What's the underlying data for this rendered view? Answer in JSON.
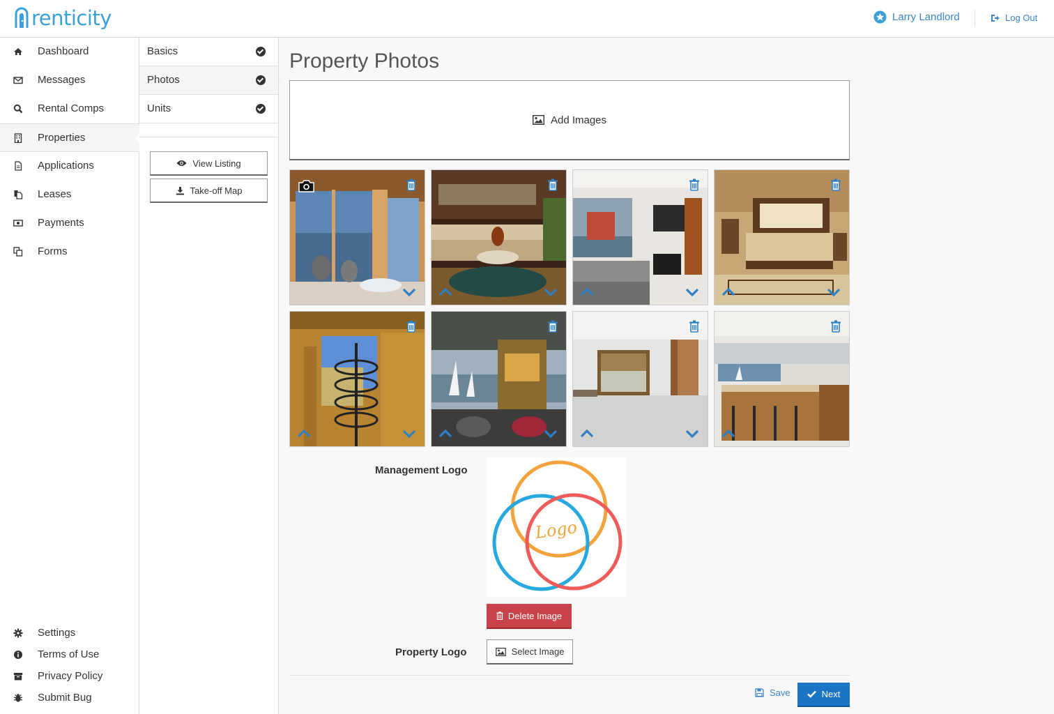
{
  "app": {
    "brand": "renticity",
    "brand_color": "#3aa0d8"
  },
  "header": {
    "user_name": "Larry Landlord",
    "user_icon": "star-circle-icon",
    "logout_label": "Log Out",
    "logout_icon": "sign-out-icon"
  },
  "sidebar": {
    "items": [
      {
        "label": "Dashboard",
        "icon": "home-icon"
      },
      {
        "label": "Messages",
        "icon": "envelope-icon"
      },
      {
        "label": "Rental Comps",
        "icon": "search-icon"
      },
      {
        "label": "Properties",
        "icon": "building-icon",
        "active": true
      },
      {
        "label": "Applications",
        "icon": "file-icon"
      },
      {
        "label": "Leases",
        "icon": "files-icon"
      },
      {
        "label": "Payments",
        "icon": "money-icon"
      },
      {
        "label": "Forms",
        "icon": "copy-icon"
      }
    ],
    "bottom_items": [
      {
        "label": "Settings",
        "icon": "gear-icon"
      },
      {
        "label": "Terms of Use",
        "icon": "info-icon"
      },
      {
        "label": "Privacy Policy",
        "icon": "archive-icon"
      },
      {
        "label": "Submit Bug",
        "icon": "bug-icon"
      }
    ]
  },
  "subnav": {
    "items": [
      {
        "label": "Basics",
        "complete": true
      },
      {
        "label": "Photos",
        "complete": true,
        "active": true
      },
      {
        "label": "Units",
        "complete": true
      }
    ],
    "view_listing_label": "View Listing",
    "takeoff_map_label": "Take-off Map"
  },
  "main": {
    "title": "Property Photos",
    "add_images_label": "Add Images",
    "photos": [
      {
        "scene": "living room with lake view",
        "cover": true
      },
      {
        "scene": "lounge with sectional sofa"
      },
      {
        "scene": "bedroom with fireplace"
      },
      {
        "scene": "master bedroom"
      },
      {
        "scene": "spiral staircase"
      },
      {
        "scene": "deck with sailboats"
      },
      {
        "scene": "empty white room"
      },
      {
        "scene": "kitchen with bar stools"
      }
    ],
    "management_logo_label": "Management Logo",
    "management_logo_text": "Logo",
    "delete_image_label": "Delete Image",
    "property_logo_label": "Property Logo",
    "select_image_label": "Select Image",
    "save_label": "Save",
    "next_label": "Next"
  },
  "colors": {
    "accent": "#3a85c8",
    "danger": "#c9444a",
    "primary": "#1b75c4"
  }
}
